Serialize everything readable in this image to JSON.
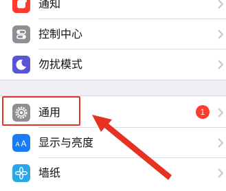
{
  "settings": {
    "items": [
      {
        "label": "通知",
        "icon": "notifications-icon",
        "color": "#ff3b30"
      },
      {
        "label": "控制中心",
        "icon": "control-center-icon",
        "color": "#8e8e93"
      },
      {
        "label": "勿扰模式",
        "icon": "moon-icon",
        "color": "#5856d6"
      },
      {
        "label": "通用",
        "icon": "gear-icon",
        "color": "#8e8e93",
        "badge": "1"
      },
      {
        "label": "显示与亮度",
        "icon": "display-brightness-icon",
        "color": "#1a7cf5"
      },
      {
        "label": "墙纸",
        "icon": "wallpaper-icon",
        "color": "#2aa7e8"
      }
    ]
  },
  "annotation": {
    "highlight_color": "#e53222"
  }
}
